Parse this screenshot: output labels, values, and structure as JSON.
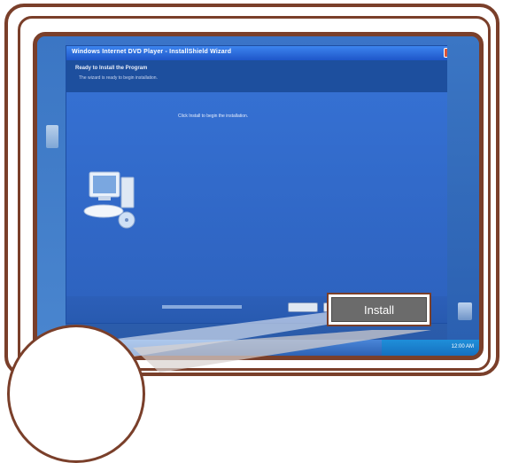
{
  "installer": {
    "title": "Windows Internet DVD Player - InstallShield Wizard",
    "header_title": "Ready to Install the Program",
    "header_subtitle": "The wizard is ready to begin installation.",
    "body_text": "Click Install to begin the installation."
  },
  "callout": {
    "button_label": "Install"
  },
  "taskbar": {
    "tray_text": "12:00 AM"
  },
  "colors": {
    "frame": "#7a3f2a",
    "desktop_blue": "#2e62b6",
    "button_gray": "#6b6b6b"
  },
  "icons": [
    "computer-setup-icon",
    "close-icon",
    "recycle-bin-icon",
    "desktop-icon"
  ]
}
